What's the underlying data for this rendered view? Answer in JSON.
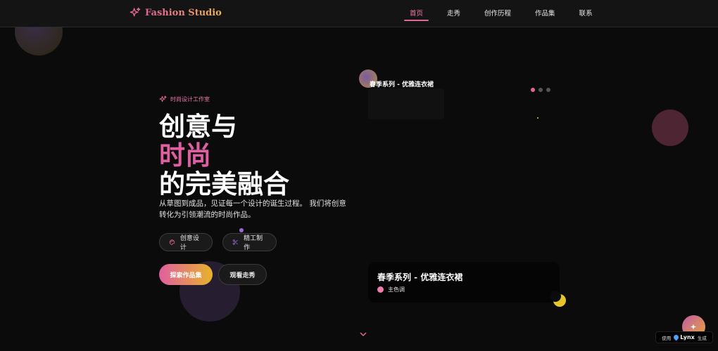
{
  "header": {
    "brand": "Fashion Studio",
    "nav": [
      {
        "label": "首页",
        "active": true
      },
      {
        "label": "走秀",
        "active": false
      },
      {
        "label": "创作历程",
        "active": false
      },
      {
        "label": "作品集",
        "active": false
      },
      {
        "label": "联系",
        "active": false
      }
    ]
  },
  "hero": {
    "tagline": "时尚设计工作室",
    "title_line1": "创意与",
    "title_line2": "时尚",
    "title_line3": "的完美融合",
    "description": "从草图到成品，见证每一个设计的诞生过程。 我们将创意转化为引领潮流的时尚作品。",
    "features": [
      "创意设计",
      "精工制作"
    ],
    "primary_cta": "探索作品集",
    "secondary_cta": "观看走秀"
  },
  "showcase": {
    "label": "春季系列 - 优雅连衣裙",
    "carousel": {
      "count": 3,
      "active_index": 0
    },
    "title": "春季系列 - 优雅连衣裙",
    "color_label": "主色调",
    "color_hex": "#f07aa8"
  },
  "badge": {
    "prefix": "使用",
    "brand": "Lynx",
    "suffix": "生成"
  },
  "colors": {
    "accent_pink": "#df5fa0",
    "accent_gold": "#e8b22a",
    "background": "#0b0b0c"
  },
  "icons": {
    "brand": "sparkle-icon",
    "tagline": "sparkle-icon",
    "feature_1": "palette-icon",
    "feature_2": "scissors-icon",
    "scroll": "chevron-down-icon",
    "fab": "sparkle-icon"
  }
}
